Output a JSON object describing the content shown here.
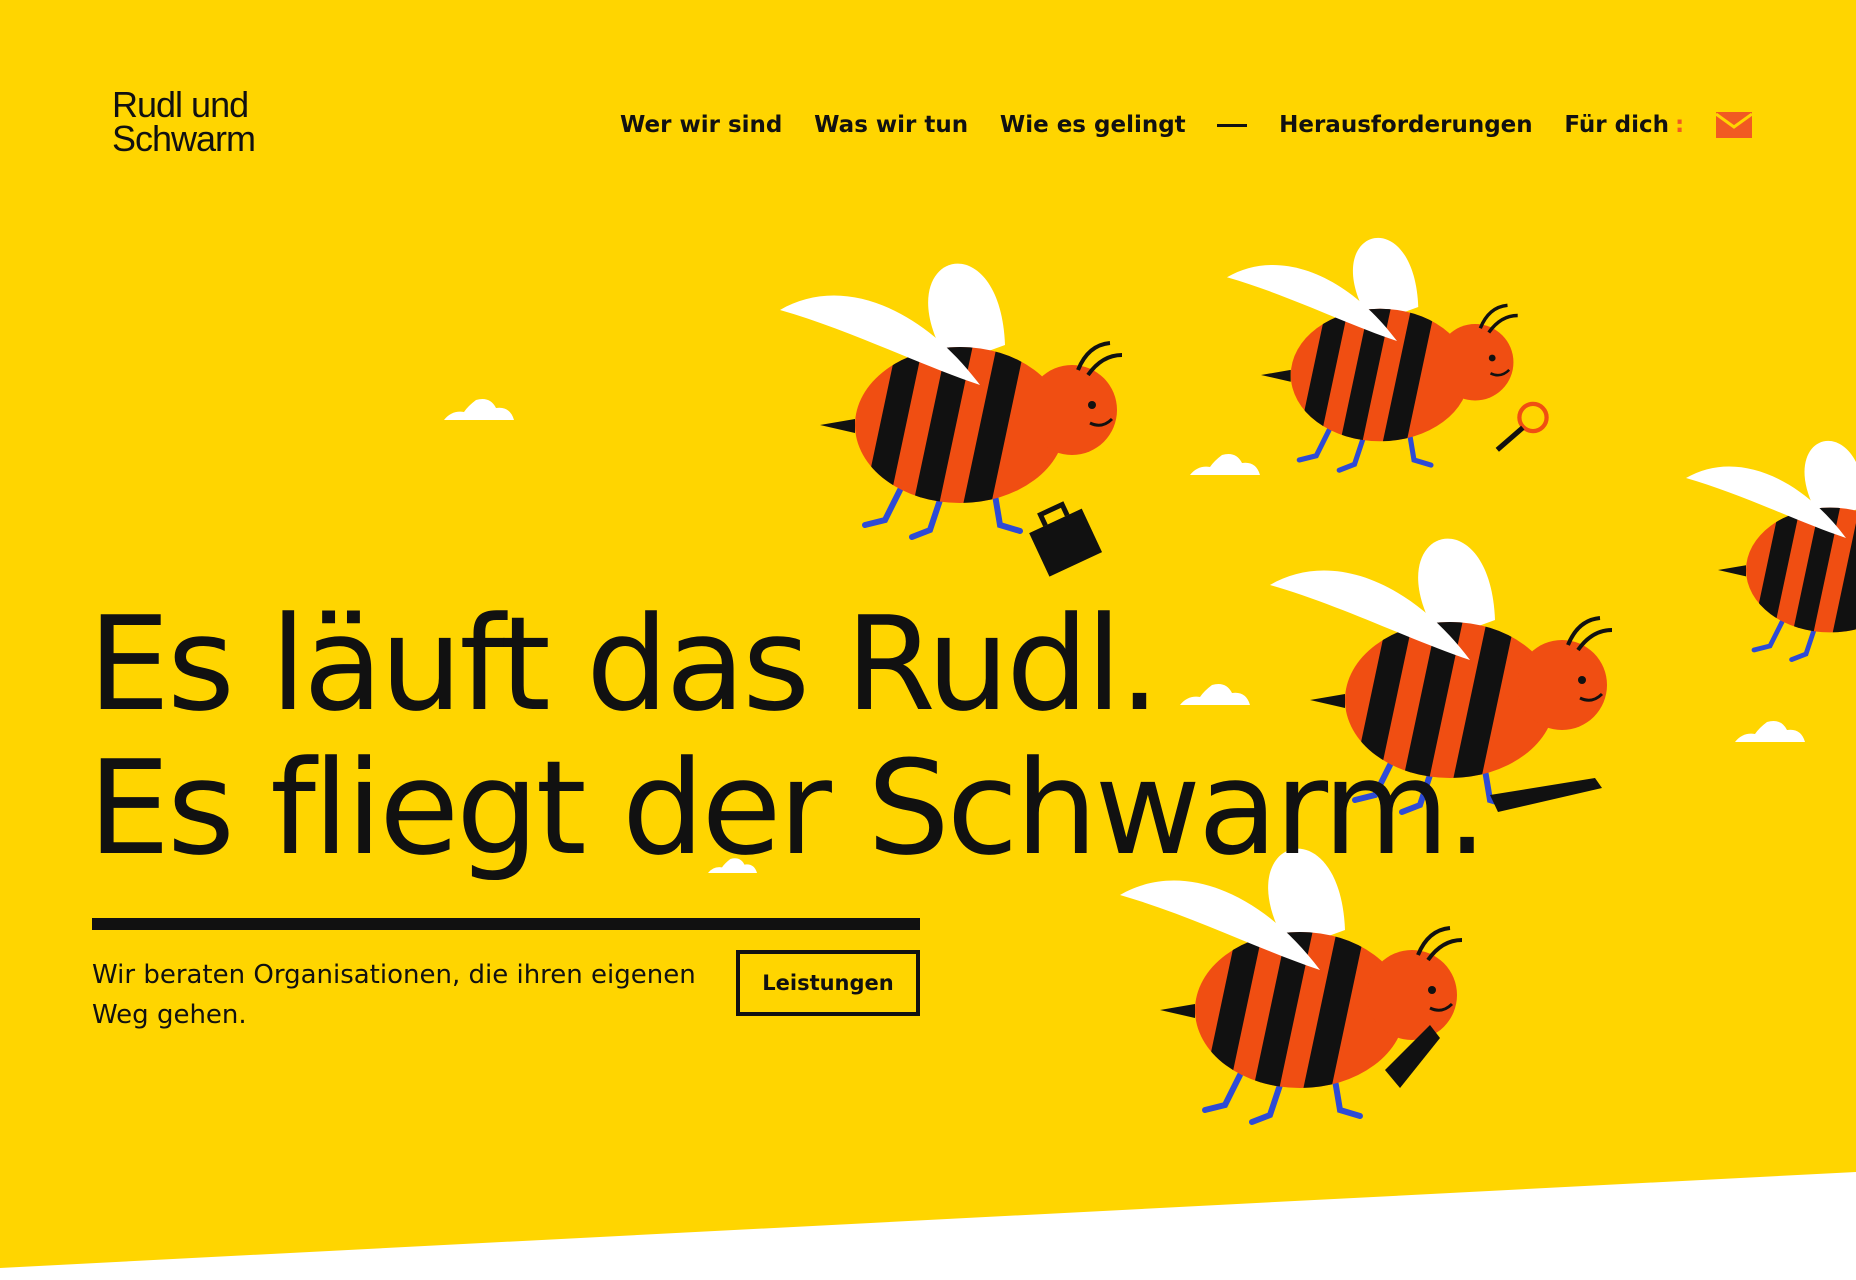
{
  "brand": {
    "logo_line1": "Rudl und",
    "logo_line2": "Schwarm"
  },
  "nav": {
    "items": [
      "Wer wir sind",
      "Was wir tun",
      "Wie es gelingt"
    ],
    "separator": "—",
    "challenges": "Herausforderungen",
    "for_you": "Für dich",
    "for_you_marker": ":",
    "mail_icon": "envelope-icon"
  },
  "hero": {
    "headline_line1": "Es läuft das Rudl.",
    "headline_line2": "Es fliegt der Schwarm.",
    "intro": "Wir beraten Organisationen, die ihren eigenen Weg gehen.",
    "cta_label": "Leistungen"
  },
  "colors": {
    "background": "#FFD500",
    "bee_body": "#F04E12",
    "bee_stripe": "#111111",
    "accent": "#F15A22",
    "bee_legs": "#2E4BD6"
  }
}
